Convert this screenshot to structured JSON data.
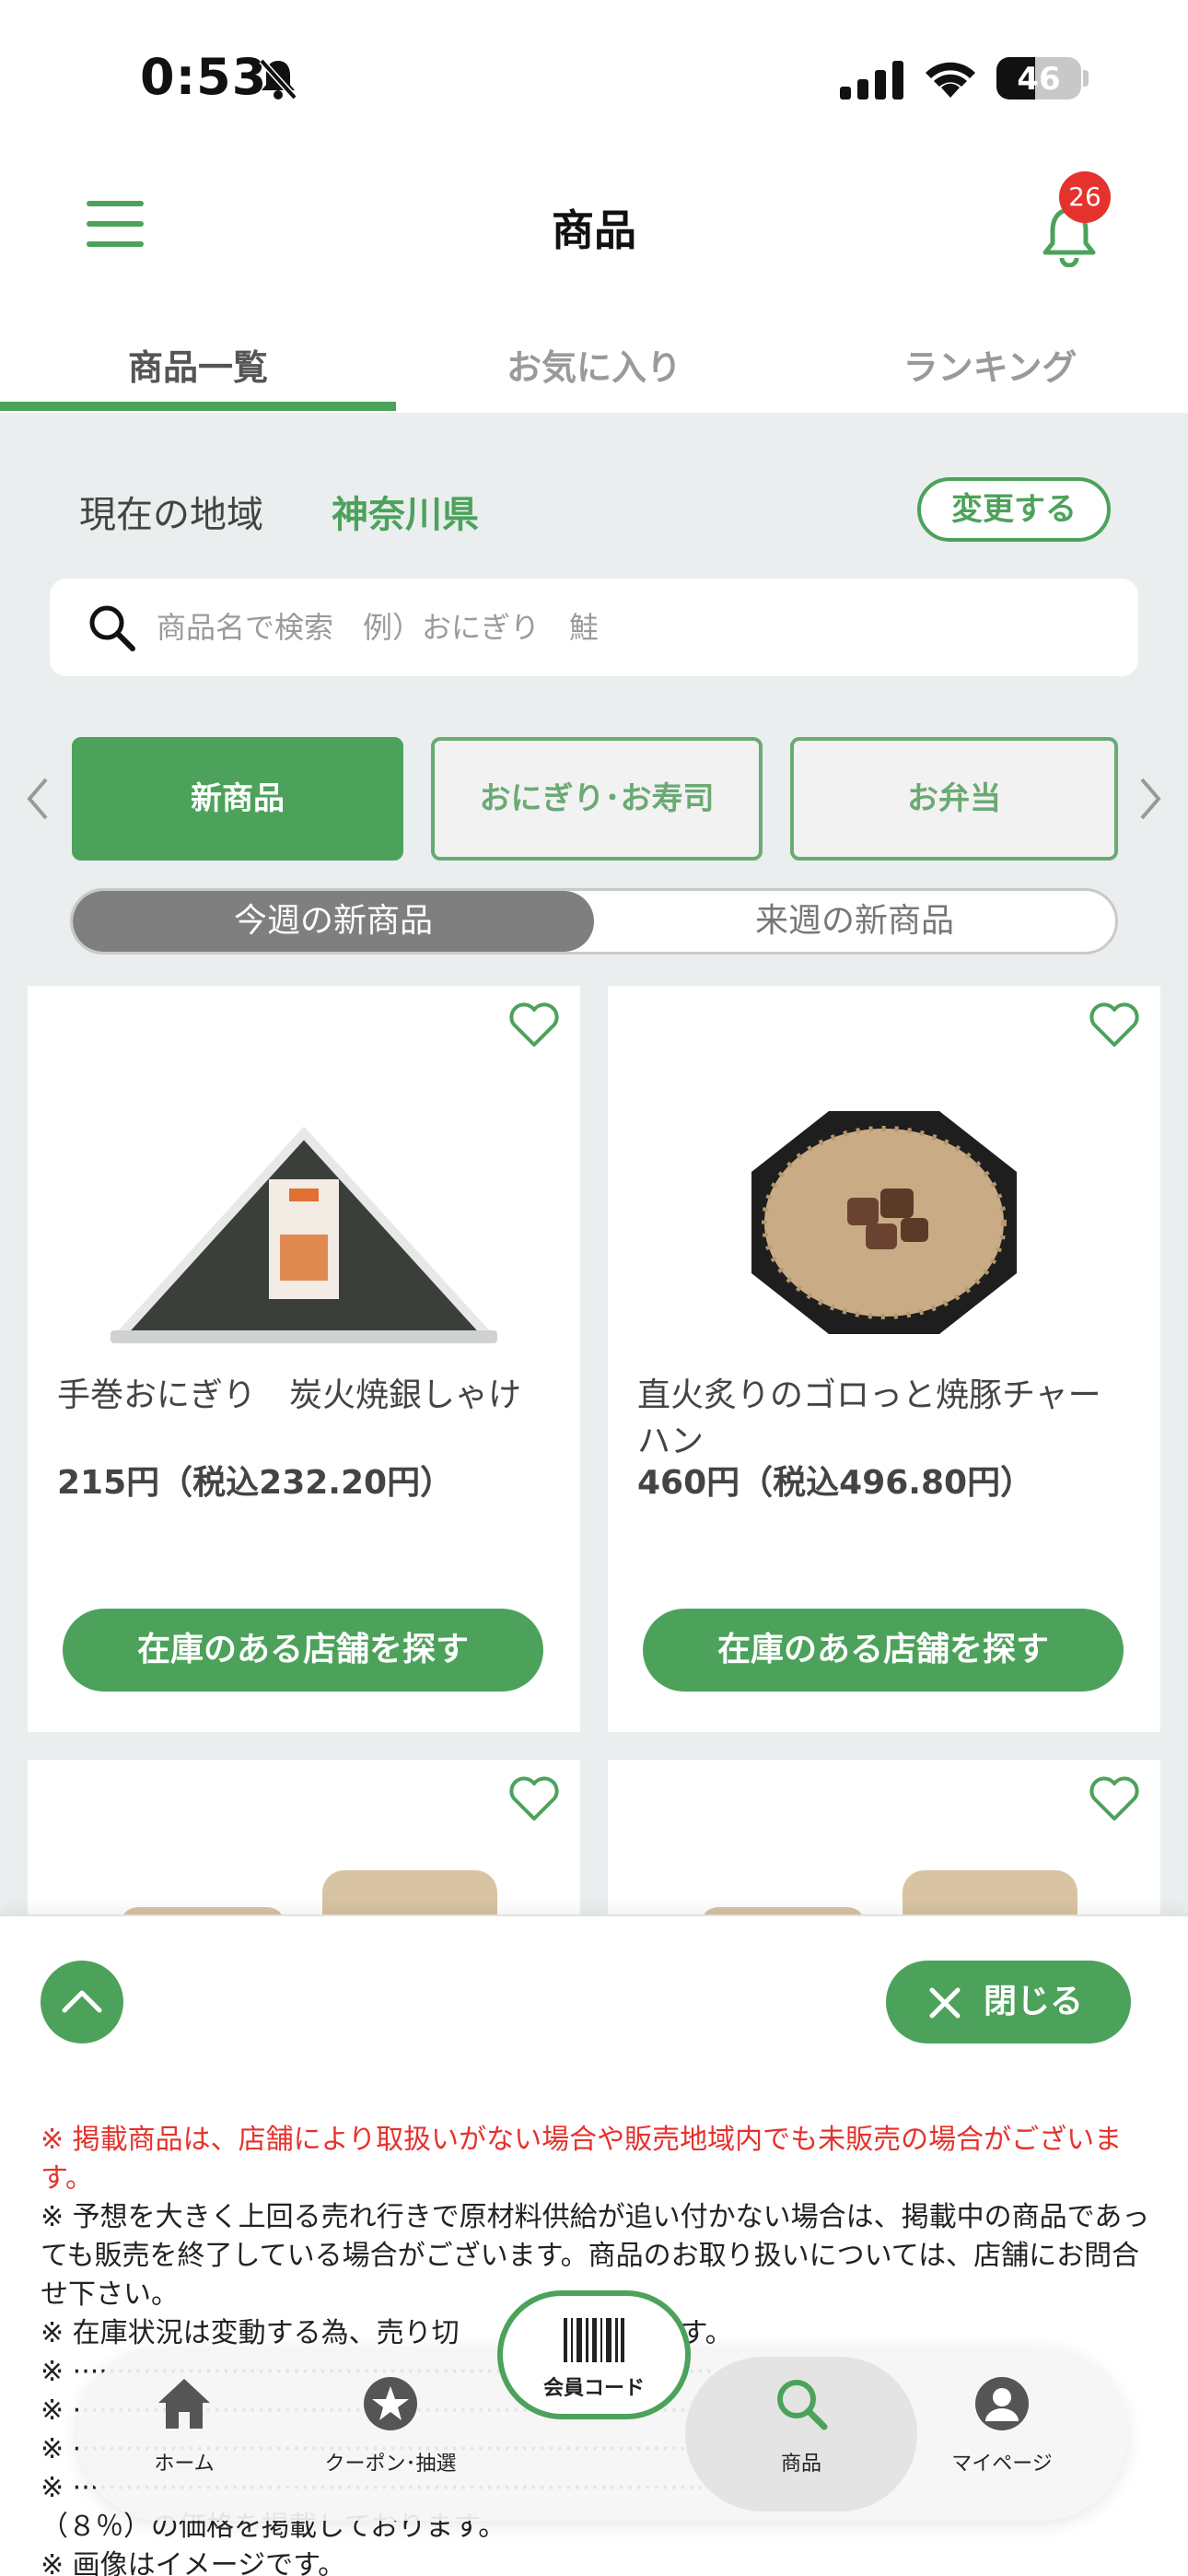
{
  "status_bar": {
    "time": "0:53",
    "battery": "46",
    "battery_fraction": 0.46
  },
  "header": {
    "title": "商品",
    "notification_count": "26"
  },
  "tabs": [
    {
      "label": "商品一覧",
      "active": true
    },
    {
      "label": "お気に入り",
      "active": false
    },
    {
      "label": "ランキング",
      "active": false
    }
  ],
  "region": {
    "label": "現在の地域",
    "value": "神奈川県",
    "change_label": "変更する"
  },
  "search": {
    "placeholder": "商品名で検索　例）おにぎり　鮭"
  },
  "categories": [
    {
      "label": "新商品",
      "active": true
    },
    {
      "label": "おにぎり･お寿司",
      "active": false
    },
    {
      "label": "お弁当",
      "active": false
    }
  ],
  "week_toggle": {
    "this_week": "今週の新商品",
    "next_week": "来週の新商品"
  },
  "products": [
    {
      "name": "手巻おにぎり　炭火焼銀しゃけ",
      "price": "215円（税込232.20円）",
      "button": "在庫のある店舗を探す"
    },
    {
      "name": "直火炙りのゴロっと焼豚チャーハン",
      "price": "460円（税込496.80円）",
      "button": "在庫のある店舗を探す"
    }
  ],
  "sheet": {
    "close_label": "閉じる",
    "note_red": "※ 掲載商品は、店舗により取扱いがない場合や販売地域内でも未販売の場合がございます。",
    "note_1": "※ 予想を大きく上回る売れ行きで原材料供給が追い付かない場合は、掲載中の商品であっても販売を終了している場合がございます。商品のお取り扱いについては、店舗にお問合せ下さい。",
    "note_2": "※ 在庫状況は変動する為、売り切",
    "note_2b": "ざいます。",
    "note_3": "（８％）の価格を掲載しております。",
    "note_4": "※ 画像はイメージです。"
  },
  "bottom_nav": {
    "member_code": "会員コード",
    "items": [
      {
        "label": "ホーム",
        "icon": "home-icon"
      },
      {
        "label": "クーポン･抽選",
        "icon": "star-icon"
      },
      {
        "label": "商品",
        "icon": "search-icon",
        "active": true
      },
      {
        "label": "マイページ",
        "icon": "person-icon"
      }
    ]
  },
  "colors": {
    "brand_green": "#4ca25a",
    "badge_red": "#e5322d",
    "note_red": "#e5322d"
  }
}
